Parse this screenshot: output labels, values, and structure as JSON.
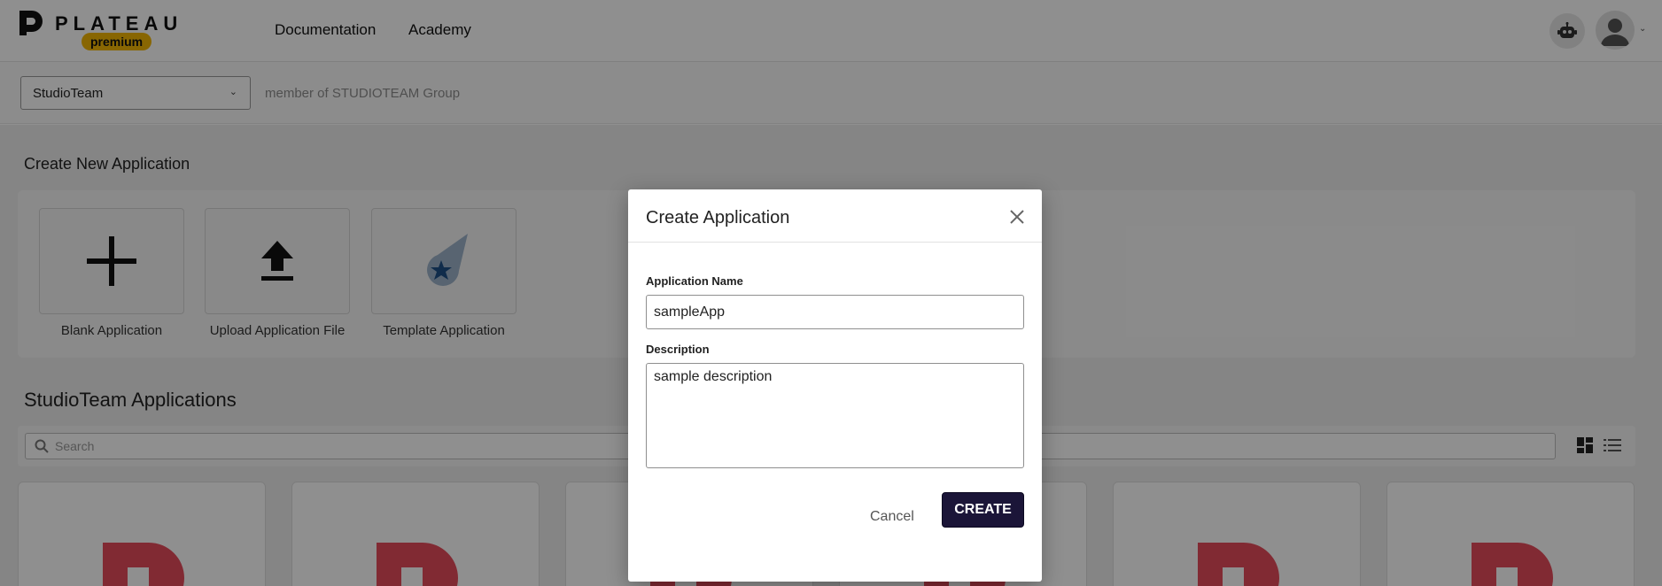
{
  "header": {
    "logo_text": "PLATEAU",
    "logo_badge": "premium",
    "nav": [
      "Documentation",
      "Academy"
    ],
    "bot_icon": "robot-icon",
    "avatar_icon": "user-avatar-icon"
  },
  "subbar": {
    "team_selected": "StudioTeam",
    "member_text": "member of STUDIOTEAM Group"
  },
  "create_section": {
    "title": "Create New Application",
    "cards": [
      {
        "label": "Blank Application",
        "icon": "plus-icon"
      },
      {
        "label": "Upload Application File",
        "icon": "upload-icon"
      },
      {
        "label": "Template Application",
        "icon": "comet-star-icon"
      }
    ]
  },
  "apps_section": {
    "title": "StudioTeam Applications",
    "search_placeholder": "Search",
    "tile_count": 6
  },
  "modal": {
    "title": "Create Application",
    "name_label": "Application Name",
    "name_value": "sampleApp",
    "description_label": "Description",
    "description_value": "sample description",
    "cancel_label": "Cancel",
    "create_label": "CREATE"
  },
  "colors": {
    "primary_button": "#1b1538",
    "badge": "#f2b705",
    "tile_logo": "#e74c5b"
  }
}
